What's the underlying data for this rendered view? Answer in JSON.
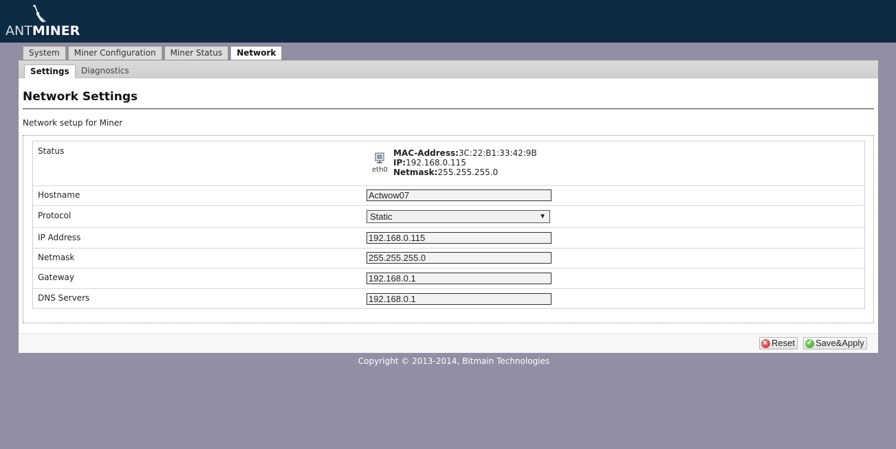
{
  "header": {
    "logo_ant": "ANT",
    "logo_miner": "MINER"
  },
  "tabs": [
    {
      "label": "System",
      "active": false
    },
    {
      "label": "Miner Configuration",
      "active": false
    },
    {
      "label": "Miner Status",
      "active": false
    },
    {
      "label": "Network",
      "active": true
    }
  ],
  "subtabs": [
    {
      "label": "Settings",
      "active": true
    },
    {
      "label": "Diagnostics",
      "active": false
    }
  ],
  "page": {
    "title": "Network Settings",
    "description": "Network setup for Miner"
  },
  "status": {
    "label": "Status",
    "interface": "eth0",
    "mac_key": "MAC-Address:",
    "mac_value": "3C:22:B1:33:42:9B",
    "ip_key": "IP:",
    "ip_value": "192.168.0.115",
    "netmask_key": "Netmask:",
    "netmask_value": "255.255.255.0"
  },
  "fields": {
    "hostname": {
      "label": "Hostname",
      "value": "Actwow07"
    },
    "protocol": {
      "label": "Protocol",
      "value": "Static"
    },
    "ip_address": {
      "label": "IP Address",
      "value": "192.168.0.115"
    },
    "netmask": {
      "label": "Netmask",
      "value": "255.255.255.0"
    },
    "gateway": {
      "label": "Gateway",
      "value": "192.168.0.1"
    },
    "dns": {
      "label": "DNS Servers",
      "value": "192.168.0.1"
    }
  },
  "buttons": {
    "reset": "Reset",
    "save_apply": "Save&Apply"
  },
  "footer": {
    "copyright": "Copyright © 2013-2014, Bitmain Technologies"
  },
  "colors": {
    "header_bg": "#0e2b44",
    "page_bg": "#928ea3"
  },
  "icons": {
    "interface": "network-port-icon",
    "reset": "cancel-circle-icon",
    "save": "check-circle-icon"
  }
}
